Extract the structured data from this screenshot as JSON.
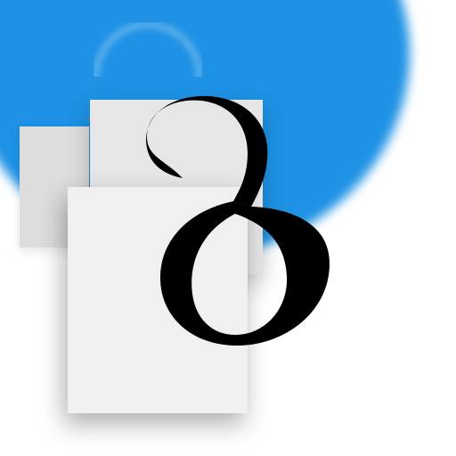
{
  "colors": {
    "background": "#ffffff",
    "blue_circle": "#1f92e5",
    "glyph": "#000000",
    "sheet_front": "#f1f0f1",
    "sheet_back": "#e7e6e6",
    "sheet_back_left": "#dedddd"
  },
  "icons": {
    "main_glyph": "delta-letter-icon",
    "document": "document-stack-icon",
    "background": "blurred-blue-circle-icon"
  }
}
